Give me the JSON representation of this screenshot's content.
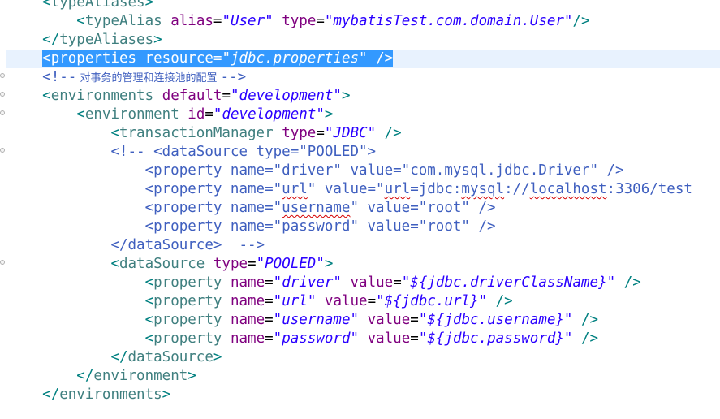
{
  "editor": {
    "selected_line": "<properties resource=\"jdbc.properties\" />",
    "lines": [
      {
        "indent": "    ",
        "open": "<",
        "name": "typeAliases",
        "close": ">"
      },
      {
        "indent": "        ",
        "open": "<",
        "name": "typeAlias",
        "a1": "alias",
        "v1": "\"User\"",
        "a2": "type",
        "v2": "\"mybatisTest.com.domain.User\"",
        "close": "/>"
      },
      {
        "indent": "    ",
        "open": "</",
        "name": "typeAliases",
        "close": ">"
      },
      {
        "indent": "    ",
        "open": "<",
        "name": "properties",
        "a1": "resource",
        "v1": "\"jdbc.properties\"",
        "close": " />"
      },
      {
        "indent": "    ",
        "comment_open": "<!--",
        "comment_text": " 对事务的管理和连接池的配置 ",
        "comment_close": "-->"
      },
      {
        "indent": "    ",
        "open": "<",
        "name": "environments",
        "a1": "default",
        "v1": "\"development\"",
        "close": ">"
      },
      {
        "indent": "        ",
        "open": "<",
        "name": "environment",
        "a1": "id",
        "v1": "\"development\"",
        "close": ">"
      },
      {
        "indent": "            ",
        "open": "<",
        "name": "transactionManager",
        "a1": "type",
        "v1": "\"JDBC\"",
        "close": " />"
      },
      {
        "indent": "            ",
        "text": "<!-- <dataSource type=\"POOLED\">"
      },
      {
        "indent": "                ",
        "text_pre": "<property name=\"driver\" value=\"com.mysql.jdbc.Driver\" />"
      },
      {
        "indent": "                ",
        "p1": "<property name=\"",
        "w1": "url",
        "p2": "\" value=\"",
        "w2": "url",
        "p3": "=jdbc:",
        "w3": "mysql",
        "p4": "://",
        "w4": "localhost",
        "p5": ":3306/test"
      },
      {
        "indent": "                ",
        "p1": "<property name=\"",
        "w1": "username",
        "p2": "\" value=\"root\" />"
      },
      {
        "indent": "                ",
        "text": "<property name=\"password\" value=\"root\" />"
      },
      {
        "indent": "            ",
        "text": "</dataSource>  -->"
      },
      {
        "indent": "            ",
        "open": "<",
        "name": "dataSource",
        "a1": "type",
        "v1": "\"POOLED\"",
        "close": ">"
      },
      {
        "indent": "                ",
        "open": "<",
        "name": "property",
        "a1": "name",
        "v1": "\"driver\"",
        "a2": "value",
        "v2": "\"${jdbc.driverClassName}\"",
        "close": " />"
      },
      {
        "indent": "                ",
        "open": "<",
        "name": "property",
        "a1": "name",
        "v1": "\"url\"",
        "a2": "value",
        "v2": "\"${jdbc.url}\"",
        "close": " />"
      },
      {
        "indent": "                ",
        "open": "<",
        "name": "property",
        "a1": "name",
        "v1": "\"username\"",
        "a2": "value",
        "v2": "\"${jdbc.username}\"",
        "close": " />"
      },
      {
        "indent": "                ",
        "open": "<",
        "name": "property",
        "a1": "name",
        "v1": "\"password\"",
        "a2": "value",
        "v2": "\"${jdbc.password}\"",
        "close": " />"
      },
      {
        "indent": "            ",
        "open": "</",
        "name": "dataSource",
        "close": ">"
      },
      {
        "indent": "        ",
        "open": "</",
        "name": "environment",
        "close": ">"
      },
      {
        "indent": "    ",
        "open": "</",
        "name": "environments",
        "close": ">"
      }
    ]
  },
  "colors": {
    "tag": "#3f7f7f",
    "attribute": "#7f007f",
    "value": "#2a00ff",
    "comment": "#3f5fbf",
    "selection": "#3399ff"
  }
}
